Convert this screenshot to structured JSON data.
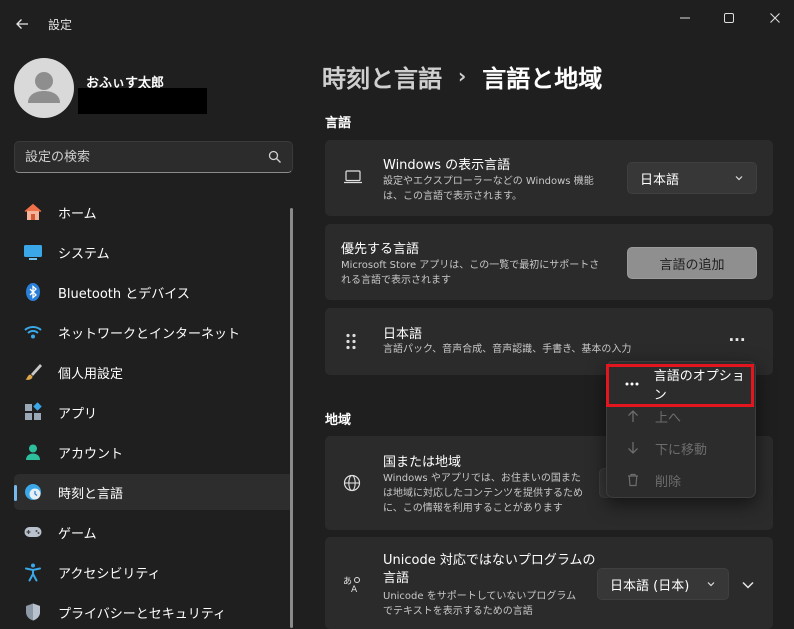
{
  "window": {
    "title": "設定",
    "colors": {
      "background": "#1f1f1f",
      "accent": "#76b9ed",
      "highlight": "#e3161f"
    }
  },
  "user": {
    "name": "おふぃす太郎"
  },
  "search": {
    "placeholder": "設定の検索"
  },
  "nav": {
    "items": [
      {
        "label": "ホーム",
        "icon": "home-icon"
      },
      {
        "label": "システム",
        "icon": "system-icon"
      },
      {
        "label": "Bluetooth とデバイス",
        "icon": "bluetooth-icon"
      },
      {
        "label": "ネットワークとインターネット",
        "icon": "wifi-icon"
      },
      {
        "label": "個人用設定",
        "icon": "brush-icon"
      },
      {
        "label": "アプリ",
        "icon": "apps-icon"
      },
      {
        "label": "アカウント",
        "icon": "account-icon"
      },
      {
        "label": "時刻と言語",
        "icon": "time-language-icon",
        "selected": true
      },
      {
        "label": "ゲーム",
        "icon": "gamepad-icon"
      },
      {
        "label": "アクセシビリティ",
        "icon": "accessibility-icon"
      },
      {
        "label": "プライバシーとセキュリティ",
        "icon": "shield-icon"
      }
    ]
  },
  "header": {
    "parent": "時刻と言語",
    "separator": "›",
    "current": "言語と地域"
  },
  "language_section": {
    "title": "言語",
    "display_language": {
      "title": "Windows の表示言語",
      "desc": "設定やエクスプローラーなどの Windows 機能は、この言語で表示されます。",
      "value": "日本語"
    },
    "preferred": {
      "title": "優先する言語",
      "desc": "Microsoft Store アプリは、この一覧で最初にサポートされる言語で表示されます",
      "add_button": "言語の追加"
    },
    "japanese": {
      "title": "日本語",
      "desc": "言語パック、音声合成、音声認識、手書き、基本の入力",
      "more": "···"
    }
  },
  "context_menu": {
    "items": [
      {
        "label": "言語のオプション",
        "icon": "more-icon",
        "enabled": true
      },
      {
        "label": "上へ",
        "icon": "arrow-up-icon",
        "enabled": false
      },
      {
        "label": "下に移動",
        "icon": "arrow-down-icon",
        "enabled": false
      },
      {
        "label": "削除",
        "icon": "trash-icon",
        "enabled": false
      }
    ]
  },
  "region_section": {
    "title": "地域",
    "country": {
      "title": "国または地域",
      "desc": "Windows やアプリでは、お住まいの国または地域に対応したコンテンツを提供するために、この情報を利用することがあります"
    },
    "unicode": {
      "title": "Unicode 対応ではないプログラムの言語",
      "desc": "Unicode をサポートしていないプログラムでテキストを表示するための言語",
      "value": "日本語 (日本)"
    }
  }
}
